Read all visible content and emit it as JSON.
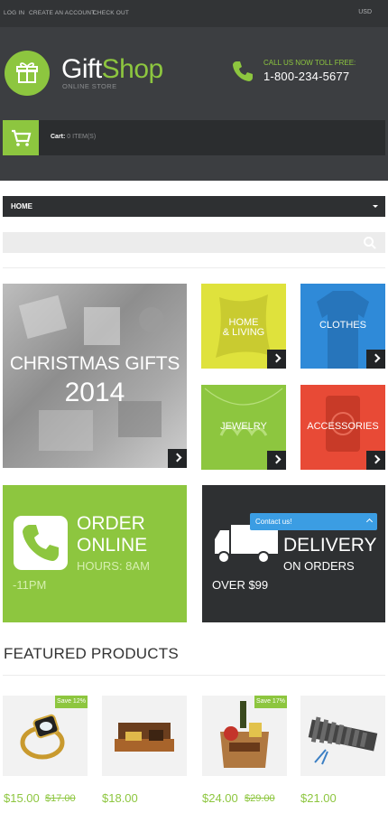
{
  "topbar": {
    "links": [
      "LOG IN",
      "CREATE AN ACCOUNT",
      "CHECK OUT"
    ],
    "currency": "USD"
  },
  "header": {
    "logo_gift": "Gift",
    "logo_shop": "Shop",
    "logo_sub": "ONLINE STORE",
    "call_label": "CALL US NOW TOLL FREE:",
    "phone": "1-800-234-5677",
    "cart_label": "Cart:",
    "cart_items": "0 ITEM(S)"
  },
  "nav": {
    "label": "HOME"
  },
  "banners": {
    "xmas_title": "CHRISTMAS GIFTS",
    "xmas_year": "2014",
    "home_line1": "HOME",
    "home_line2": "& LIVING",
    "clothes": "CLOTHES",
    "jewelry": "JEWELRY",
    "accessories": "ACCESSORIES",
    "order_line1": "ORDER",
    "order_line2": "ONLINE",
    "order_hours": "HOURS: 8AM",
    "order_hours2": "-11PM",
    "delivery_line1": "DELIVERY",
    "delivery_line2": "ON ORDERS",
    "delivery_line3": "OVER $99",
    "contact": "Contact us!"
  },
  "featured": {
    "title": "FEATURED PRODUCTS",
    "products": [
      {
        "badge": "Save 12%",
        "price": "$15.00",
        "old_price": "$17.00",
        "image": "ring"
      },
      {
        "badge": "",
        "price": "$18.00",
        "old_price": "",
        "image": "chocolates"
      },
      {
        "badge": "Save 17%",
        "price": "$24.00",
        "old_price": "$29.00",
        "image": "gift-basket"
      },
      {
        "badge": "",
        "price": "$21.00",
        "old_price": "",
        "image": "xylophone"
      }
    ]
  },
  "colors": {
    "accent": "#8dc63f",
    "dark": "#3c3e41",
    "blue": "#2f8ad8",
    "red": "#e84a36",
    "yellow": "#dfe23c"
  }
}
